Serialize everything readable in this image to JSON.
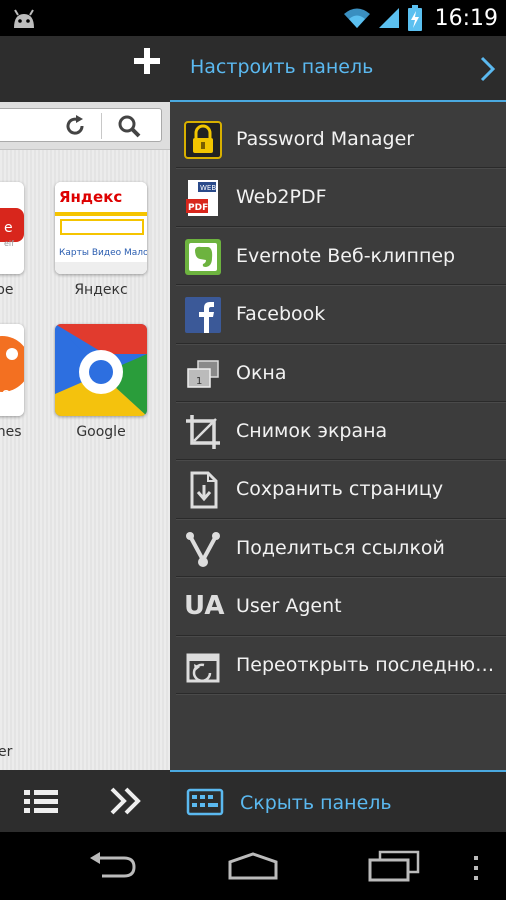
{
  "status_bar": {
    "time": "16:19",
    "icons": [
      "android-icon",
      "wifi-icon",
      "signal-icon",
      "battery-charging-icon"
    ]
  },
  "browser": {
    "tiles": [
      {
        "id": "youtube",
        "label": "be"
      },
      {
        "id": "yandex",
        "label": "Яндекс",
        "logo_text": "Яндекс",
        "links_text": "Карты  Видео  Мало"
      },
      {
        "id": "games",
        "label": "mes",
        "fragment_text": "es"
      },
      {
        "id": "google",
        "label": "Google"
      }
    ],
    "bottom_fragment": "er"
  },
  "panel": {
    "title": "Настроить панель",
    "items": [
      {
        "label": "Password Manager",
        "icon": "lock-icon"
      },
      {
        "label": "Web2PDF",
        "icon": "web2pdf-icon"
      },
      {
        "label": "Evernote Веб-клиппер",
        "icon": "evernote-icon"
      },
      {
        "label": "Facebook",
        "icon": "facebook-icon"
      },
      {
        "label": "Окна",
        "icon": "windows-icon"
      },
      {
        "label": "Снимок экрана",
        "icon": "crop-icon"
      },
      {
        "label": "Сохранить страницу",
        "icon": "save-page-icon"
      },
      {
        "label": "Поделиться ссылкой",
        "icon": "share-icon"
      },
      {
        "label": "User Agent",
        "icon": "user-agent-icon",
        "icon_text": "UA"
      },
      {
        "label": "Переоткрыть последнюю...",
        "icon": "reopen-icon"
      }
    ],
    "footer_label": "Скрыть панель"
  },
  "colors": {
    "accent": "#4aa9e0",
    "accent_text": "#5bb9f0",
    "panel_bg": "#3c3c3c"
  }
}
